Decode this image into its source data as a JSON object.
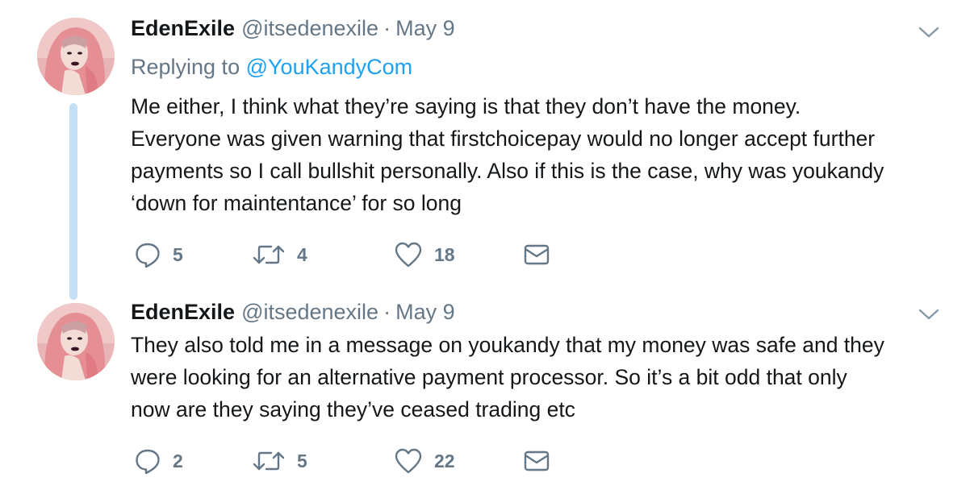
{
  "tweets": [
    {
      "display_name": "EdenExile",
      "handle": "@itsedenexile",
      "separator": "·",
      "date": "May 9",
      "replying_prefix": "Replying to",
      "replying_to": "@YouKandyCom",
      "text_lines": [
        "Me either, I think what they’re saying is that they don’t have the money.",
        "Everyone was given warning that firstchoicepay would no longer accept further",
        "payments so I call bullshit personally. Also if this is the case, why was youkandy",
        "‘down for maintentance’ for so long"
      ],
      "replies": "5",
      "retweets": "4",
      "likes": "18"
    },
    {
      "display_name": "EdenExile",
      "handle": "@itsedenexile",
      "separator": "·",
      "date": "May 9",
      "text_lines": [
        "They also told me in a message on youkandy that my money was safe and they",
        "were looking for an alternative payment processor. So it’s a bit odd that only",
        "now are they saying they’ve ceased trading etc"
      ],
      "replies": "2",
      "retweets": "5",
      "likes": "22"
    }
  ],
  "icons": {
    "reply": "reply-icon",
    "retweet": "retweet-icon",
    "like": "heart-icon",
    "dm": "envelope-icon",
    "menu": "chevron-down-icon"
  },
  "colors": {
    "text": "#14171a",
    "secondary": "#657786",
    "link": "#1da1f2",
    "thread_line": "#c4dff6"
  }
}
